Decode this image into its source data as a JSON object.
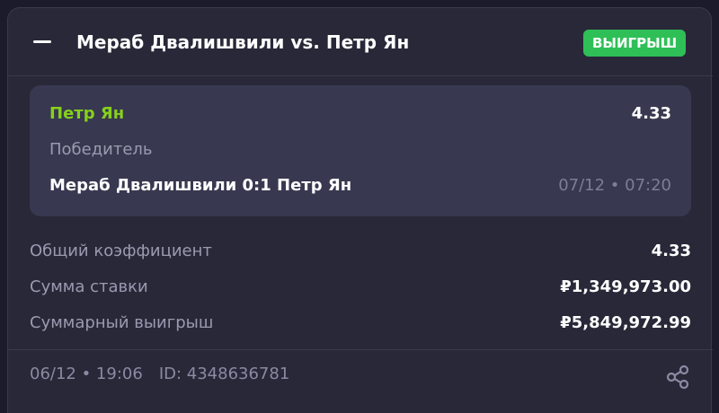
{
  "header": {
    "collapse_icon": "minus-icon",
    "title": "Мераб Двалишвили vs. Петр Ян",
    "badge": "ВЫИГРЫШ",
    "badge_color": "#2fbf57"
  },
  "selection": {
    "name": "Петр Ян",
    "name_color": "#86d11c",
    "odds": "4.33",
    "market": "Победитель",
    "match": "Мераб Двалишвили 0:1 Петр Ян",
    "datetime": "07/12 • 07:20"
  },
  "summary": [
    {
      "label": "Общий коэффициент",
      "value": "4.33"
    },
    {
      "label": "Сумма ставки",
      "value": "₽1,349,973.00"
    },
    {
      "label": "Суммарный выигрыш",
      "value": "₽5,849,972.99"
    }
  ],
  "footer": {
    "datetime": "06/12 • 19:06",
    "id": "ID: 4348636781",
    "share_icon": "share-icon"
  }
}
